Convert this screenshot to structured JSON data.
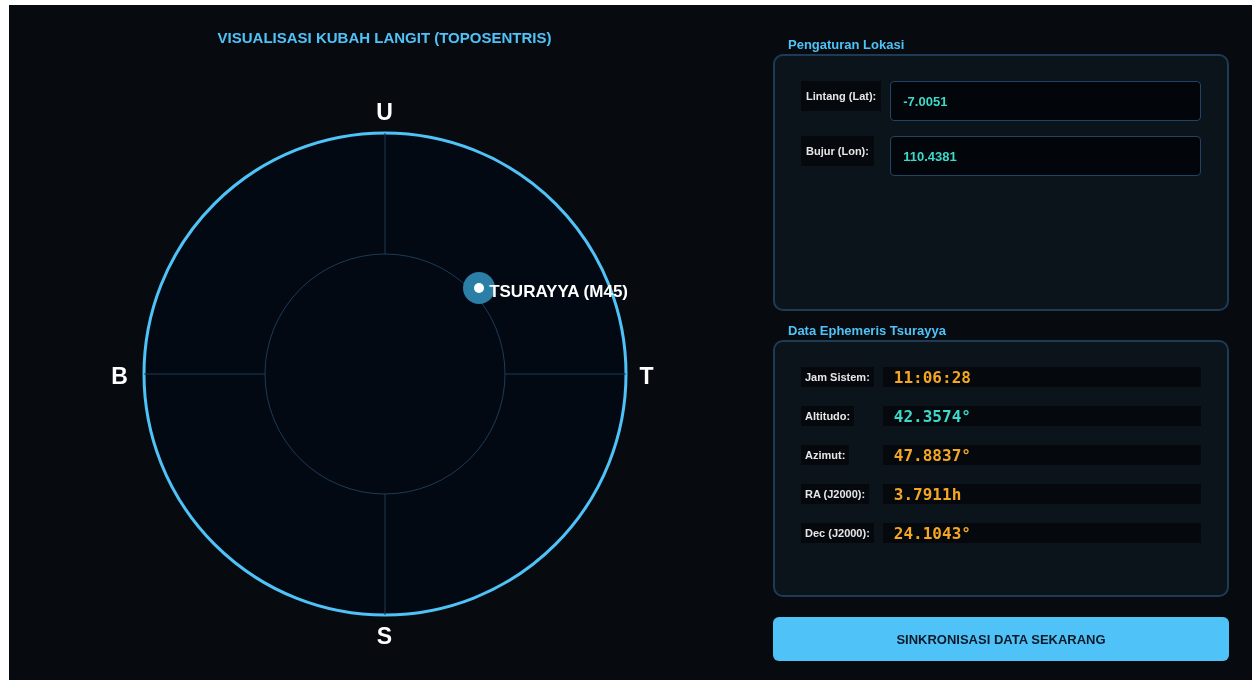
{
  "sky_dome": {
    "title": "VISUALISASI KUBAH LANGIT (TOPOSENTRIS)",
    "directions": [
      {
        "label": "U",
        "kind": "north"
      },
      {
        "label": "T",
        "kind": "east"
      },
      {
        "label": "S",
        "kind": "south"
      },
      {
        "label": "B",
        "kind": "west"
      }
    ],
    "object": {
      "name": "TSURAYYA (M45)"
    }
  },
  "location": {
    "heading": "Pengaturan Lokasi",
    "fields": [
      {
        "label": "Lintang (Lat):",
        "value": "-7.0051"
      },
      {
        "label": "Bujur (Lon):",
        "value": "110.4381"
      }
    ]
  },
  "ephemeris": {
    "heading": "Data Ephemeris Tsurayya",
    "rows": [
      {
        "label": "Jam Sistem:",
        "value": "11:06:28",
        "color": "#f5a623"
      },
      {
        "label": "Altitudo:",
        "value": "42.3574°",
        "color": "#3dd9c9"
      },
      {
        "label": "Azimut:",
        "value": "47.8837°",
        "color": "#f5a623"
      },
      {
        "label": "RA (J2000):",
        "value": "3.7911h",
        "color": "#f5a623"
      },
      {
        "label": "Dec (J2000):",
        "value": "24.1043°",
        "color": "#f5a623"
      }
    ]
  },
  "sync_button": "SINKRONISASI DATA SEKARANG"
}
